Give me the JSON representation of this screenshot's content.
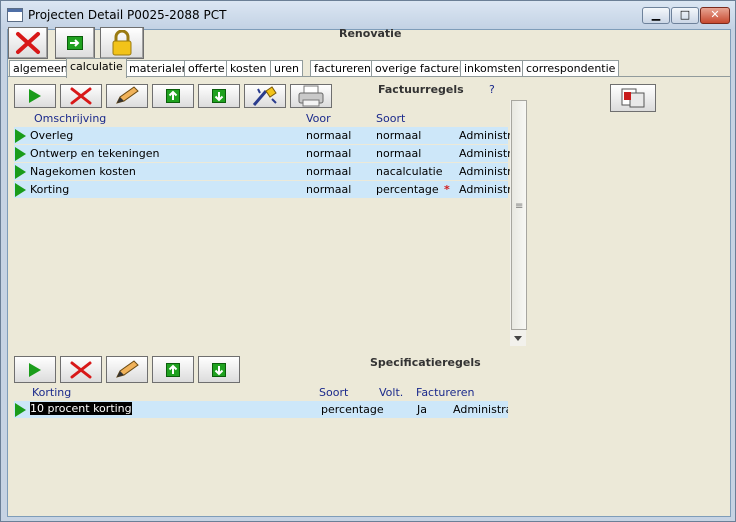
{
  "window": {
    "title": "Projecten Detail   P0025-2088   PCT",
    "minimize_label": "▁",
    "maximize_label": "□",
    "close_label": "✕"
  },
  "project": {
    "name": "Renovatie"
  },
  "tabs": [
    {
      "label": "algemeen"
    },
    {
      "label": "calculatie"
    },
    {
      "label": "materialen"
    },
    {
      "label": "offerte"
    },
    {
      "label": "kosten"
    },
    {
      "label": "uren"
    },
    {
      "label": "factureren"
    },
    {
      "label": "overige facturen"
    },
    {
      "label": "inkomsten"
    },
    {
      "label": "correspondentie"
    }
  ],
  "factuurregels": {
    "title": "Factuurregels",
    "help": "?",
    "columns": {
      "omschrijving": "Omschrijving",
      "voor": "Voor",
      "soort": "Soort"
    },
    "rows": [
      {
        "omschrijving": "Overleg",
        "voor": "normaal",
        "soort": "normaal",
        "flag": "",
        "admin": "Administra"
      },
      {
        "omschrijving": "Ontwerp en tekeningen",
        "voor": "normaal",
        "soort": "normaal",
        "flag": "",
        "admin": "Administra"
      },
      {
        "omschrijving": "Nagekomen kosten",
        "voor": "normaal",
        "soort": "nacalculatie",
        "flag": "",
        "admin": "Administra"
      },
      {
        "omschrijving": "Korting",
        "voor": "normaal",
        "soort": "percentage",
        "flag": "*",
        "admin": "Administra"
      }
    ],
    "scroll_grip": "≡"
  },
  "specificatieregels": {
    "title": "Specificatieregels",
    "columns": {
      "korting": "Korting",
      "soort": "Soort",
      "volt": "Volt.",
      "factureren": "Factureren"
    },
    "rows": [
      {
        "korting": "10 procent korting",
        "soort": "percentage",
        "factureren": "Ja",
        "admin": "Administrati"
      }
    ]
  },
  "colors": {
    "row_bg": "#cde7f9",
    "pointer_green": "#1a9c1a",
    "header_blue": "#1b2a8c"
  },
  "icons": {
    "toolbar": [
      "delete-icon",
      "go-icon",
      "lock-icon"
    ],
    "factuur_toolbar": [
      "play-icon",
      "delete-icon",
      "pencil-icon",
      "move-up-icon",
      "move-down-icon",
      "wizard-icon",
      "printer-icon"
    ],
    "spec_toolbar": [
      "play-icon",
      "delete-icon",
      "pencil-icon",
      "move-up-icon",
      "move-down-icon"
    ],
    "side": "documents-icon"
  }
}
